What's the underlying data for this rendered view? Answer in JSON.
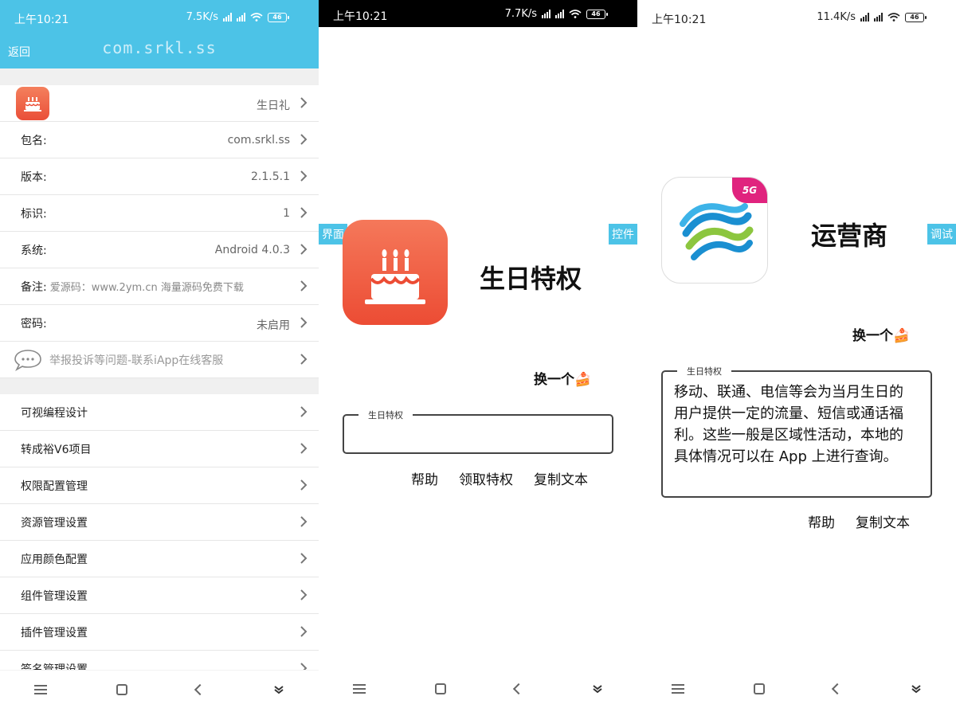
{
  "panel1": {
    "status": {
      "time": "上午10:21",
      "speed": "7.5K/s",
      "battery": "46"
    },
    "header": {
      "back": "返回",
      "title": "com.srkl.ss"
    },
    "info_rows": [
      {
        "label": "",
        "value": "生日礼"
      },
      {
        "label": "包名:",
        "value": "com.srkl.ss"
      },
      {
        "label": "版本:",
        "value": "2.1.5.1"
      },
      {
        "label": "标识:",
        "value": "1"
      },
      {
        "label": "系统:",
        "value": "Android 4.0.3"
      },
      {
        "label": "备注:",
        "value": "爱源码：www.2ym.cn 海量源码免费下载"
      },
      {
        "label": "密码:",
        "value": "未启用"
      },
      {
        "label": "",
        "value": "举报投诉等问题-联系iApp在线客服"
      }
    ],
    "menu_rows": [
      "可视编程设计",
      "转成裕V6项目",
      "权限配置管理",
      "资源管理设置",
      "应用颜色配置",
      "组件管理设置",
      "插件管理设置",
      "签名管理设置"
    ]
  },
  "panel2": {
    "status": {
      "time": "上午10:21",
      "speed": "7.7K/s",
      "battery": "46"
    },
    "left_tag": "界面",
    "right_tag": "控件",
    "title": "生日特权",
    "swap": "换一个🍰",
    "legend": "生日特权",
    "actions": [
      "帮助",
      "领取特权",
      "复制文本"
    ]
  },
  "panel3": {
    "status": {
      "time": "上午10:21",
      "speed": "11.4K/s",
      "battery": "46"
    },
    "right_tag": "调试",
    "badge": "5G",
    "title": "运营商",
    "swap": "换一个🍰",
    "legend": "生日特权",
    "description": "移动、联通、电信等会为当月生日的用户提供一定的流量、短信或通话福利。这些一般是区域性活动，本地的具体情况可以在 App 上进行查询。",
    "actions": [
      "帮助",
      "复制文本"
    ]
  },
  "colors": {
    "header_blue": "#4cc3e7",
    "app_orange": "#ec4c34",
    "badge_pink": "#e0237e"
  }
}
